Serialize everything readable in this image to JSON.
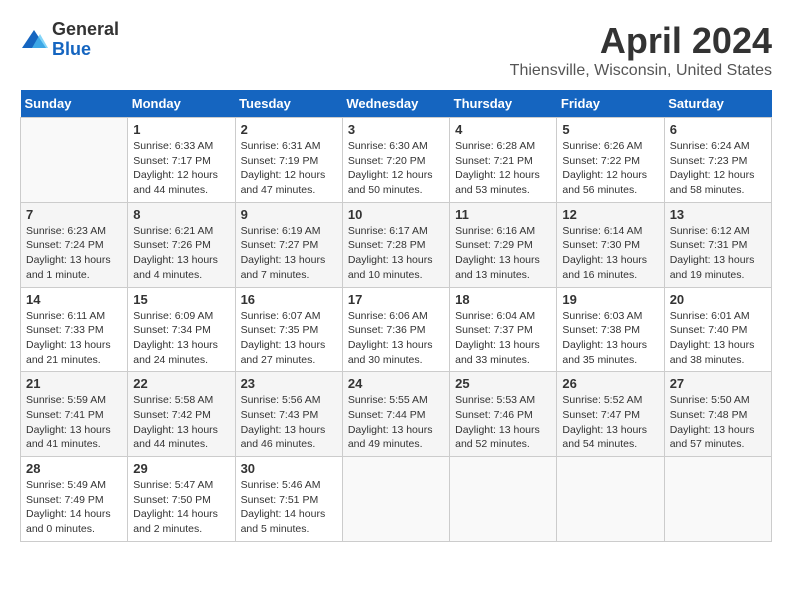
{
  "header": {
    "logo": {
      "general": "General",
      "blue": "Blue"
    },
    "title": "April 2024",
    "subtitle": "Thiensville, Wisconsin, United States"
  },
  "calendar": {
    "days_of_week": [
      "Sunday",
      "Monday",
      "Tuesday",
      "Wednesday",
      "Thursday",
      "Friday",
      "Saturday"
    ],
    "weeks": [
      [
        {
          "day": "",
          "empty": true
        },
        {
          "day": "1",
          "sunrise": "6:33 AM",
          "sunset": "7:17 PM",
          "daylight": "12 hours and 44 minutes."
        },
        {
          "day": "2",
          "sunrise": "6:31 AM",
          "sunset": "7:19 PM",
          "daylight": "12 hours and 47 minutes."
        },
        {
          "day": "3",
          "sunrise": "6:30 AM",
          "sunset": "7:20 PM",
          "daylight": "12 hours and 50 minutes."
        },
        {
          "day": "4",
          "sunrise": "6:28 AM",
          "sunset": "7:21 PM",
          "daylight": "12 hours and 53 minutes."
        },
        {
          "day": "5",
          "sunrise": "6:26 AM",
          "sunset": "7:22 PM",
          "daylight": "12 hours and 56 minutes."
        },
        {
          "day": "6",
          "sunrise": "6:24 AM",
          "sunset": "7:23 PM",
          "daylight": "12 hours and 58 minutes."
        }
      ],
      [
        {
          "day": "7",
          "sunrise": "6:23 AM",
          "sunset": "7:24 PM",
          "daylight": "13 hours and 1 minute."
        },
        {
          "day": "8",
          "sunrise": "6:21 AM",
          "sunset": "7:26 PM",
          "daylight": "13 hours and 4 minutes."
        },
        {
          "day": "9",
          "sunrise": "6:19 AM",
          "sunset": "7:27 PM",
          "daylight": "13 hours and 7 minutes."
        },
        {
          "day": "10",
          "sunrise": "6:17 AM",
          "sunset": "7:28 PM",
          "daylight": "13 hours and 10 minutes."
        },
        {
          "day": "11",
          "sunrise": "6:16 AM",
          "sunset": "7:29 PM",
          "daylight": "13 hours and 13 minutes."
        },
        {
          "day": "12",
          "sunrise": "6:14 AM",
          "sunset": "7:30 PM",
          "daylight": "13 hours and 16 minutes."
        },
        {
          "day": "13",
          "sunrise": "6:12 AM",
          "sunset": "7:31 PM",
          "daylight": "13 hours and 19 minutes."
        }
      ],
      [
        {
          "day": "14",
          "sunrise": "6:11 AM",
          "sunset": "7:33 PM",
          "daylight": "13 hours and 21 minutes."
        },
        {
          "day": "15",
          "sunrise": "6:09 AM",
          "sunset": "7:34 PM",
          "daylight": "13 hours and 24 minutes."
        },
        {
          "day": "16",
          "sunrise": "6:07 AM",
          "sunset": "7:35 PM",
          "daylight": "13 hours and 27 minutes."
        },
        {
          "day": "17",
          "sunrise": "6:06 AM",
          "sunset": "7:36 PM",
          "daylight": "13 hours and 30 minutes."
        },
        {
          "day": "18",
          "sunrise": "6:04 AM",
          "sunset": "7:37 PM",
          "daylight": "13 hours and 33 minutes."
        },
        {
          "day": "19",
          "sunrise": "6:03 AM",
          "sunset": "7:38 PM",
          "daylight": "13 hours and 35 minutes."
        },
        {
          "day": "20",
          "sunrise": "6:01 AM",
          "sunset": "7:40 PM",
          "daylight": "13 hours and 38 minutes."
        }
      ],
      [
        {
          "day": "21",
          "sunrise": "5:59 AM",
          "sunset": "7:41 PM",
          "daylight": "13 hours and 41 minutes."
        },
        {
          "day": "22",
          "sunrise": "5:58 AM",
          "sunset": "7:42 PM",
          "daylight": "13 hours and 44 minutes."
        },
        {
          "day": "23",
          "sunrise": "5:56 AM",
          "sunset": "7:43 PM",
          "daylight": "13 hours and 46 minutes."
        },
        {
          "day": "24",
          "sunrise": "5:55 AM",
          "sunset": "7:44 PM",
          "daylight": "13 hours and 49 minutes."
        },
        {
          "day": "25",
          "sunrise": "5:53 AM",
          "sunset": "7:46 PM",
          "daylight": "13 hours and 52 minutes."
        },
        {
          "day": "26",
          "sunrise": "5:52 AM",
          "sunset": "7:47 PM",
          "daylight": "13 hours and 54 minutes."
        },
        {
          "day": "27",
          "sunrise": "5:50 AM",
          "sunset": "7:48 PM",
          "daylight": "13 hours and 57 minutes."
        }
      ],
      [
        {
          "day": "28",
          "sunrise": "5:49 AM",
          "sunset": "7:49 PM",
          "daylight": "14 hours and 0 minutes."
        },
        {
          "day": "29",
          "sunrise": "5:47 AM",
          "sunset": "7:50 PM",
          "daylight": "14 hours and 2 minutes."
        },
        {
          "day": "30",
          "sunrise": "5:46 AM",
          "sunset": "7:51 PM",
          "daylight": "14 hours and 5 minutes."
        },
        {
          "day": "",
          "empty": true
        },
        {
          "day": "",
          "empty": true
        },
        {
          "day": "",
          "empty": true
        },
        {
          "day": "",
          "empty": true
        }
      ]
    ]
  }
}
